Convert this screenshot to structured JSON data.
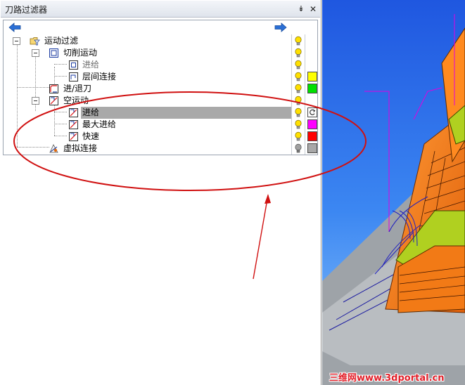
{
  "panel": {
    "title": "刀路过滤器",
    "pin_glyph": "↡",
    "close_glyph": "✕"
  },
  "nav": {
    "back_icon": "arrow-left-icon",
    "forward_icon": "arrow-right-icon"
  },
  "tree": {
    "rows": [
      {
        "label": "运动过滤",
        "icon": "folder-filter-icon",
        "expanded": true,
        "dim": false,
        "bulb": "on",
        "swatch": null
      },
      {
        "label": "切削运动",
        "icon": "cut-motion-icon",
        "expanded": true,
        "dim": false,
        "bulb": "on",
        "swatch": null
      },
      {
        "label": "进给",
        "icon": "feed-icon",
        "expanded": false,
        "dim": true,
        "bulb": "on",
        "swatch": null
      },
      {
        "label": "层间连接",
        "icon": "level-link-icon",
        "expanded": false,
        "dim": false,
        "bulb": "on",
        "swatch": "#ffff00"
      },
      {
        "label": "进/退刀",
        "icon": "lead-in-out-icon",
        "expanded": false,
        "dim": false,
        "bulb": "on",
        "swatch": "#00e000"
      },
      {
        "label": "空运动",
        "icon": "air-move-icon",
        "expanded": true,
        "dim": false,
        "bulb": "on",
        "swatch": null
      },
      {
        "label": "进给",
        "icon": "air-feed-icon",
        "expanded": false,
        "dim": false,
        "bulb": "on",
        "swatch": null,
        "selected": true
      },
      {
        "label": "最大进给",
        "icon": "max-feed-icon",
        "expanded": false,
        "dim": false,
        "bulb": "on",
        "swatch": "#ff00ff"
      },
      {
        "label": "快速",
        "icon": "rapid-icon",
        "expanded": false,
        "dim": false,
        "bulb": "on",
        "swatch": "#ff0000"
      },
      {
        "label": "虚拟连接",
        "icon": "virtual-link-icon",
        "expanded": false,
        "dim": false,
        "bulb": "off",
        "swatch": "#a8a8a8"
      }
    ]
  },
  "colors": {
    "annotation": "#d01010",
    "bulb_on": "#ffe000",
    "bulb_off": "#a0a0a0",
    "nav_arrow": "#2a6fd6"
  },
  "watermark": {
    "text": "三维网www.3dportal.cn"
  }
}
